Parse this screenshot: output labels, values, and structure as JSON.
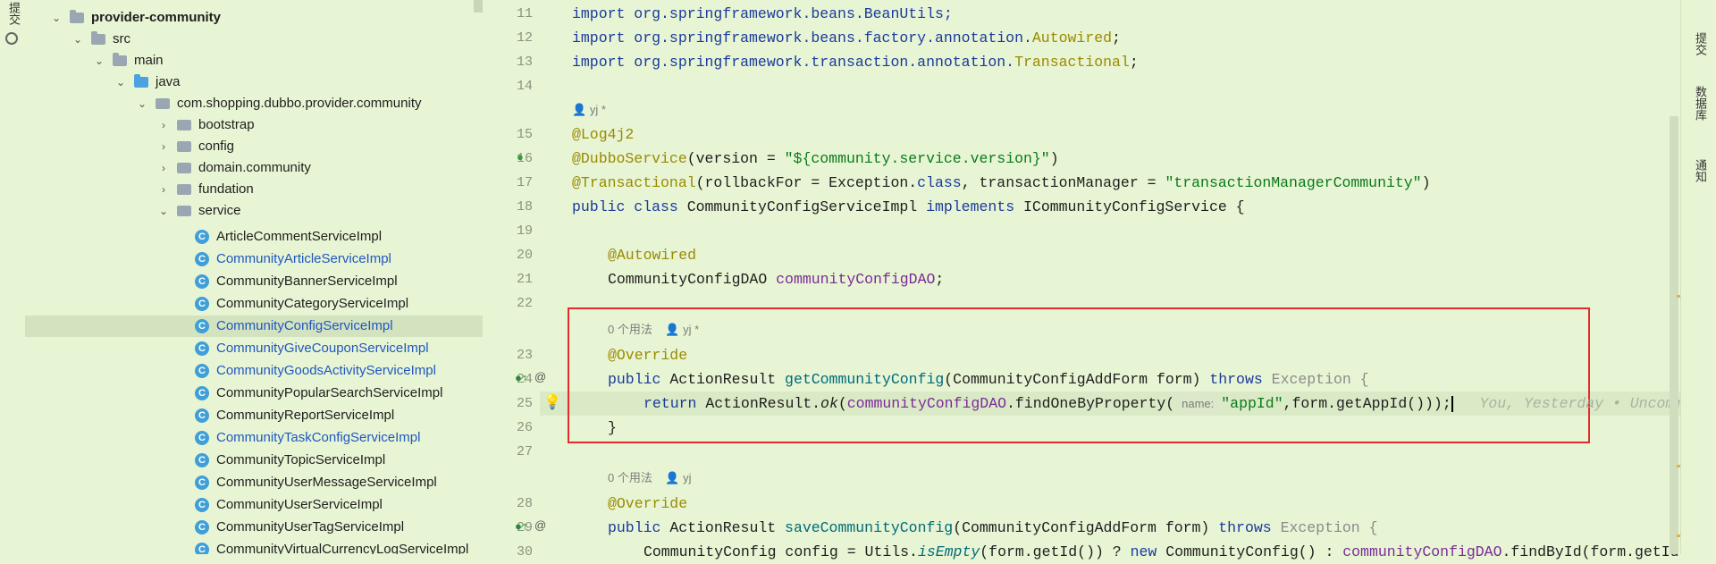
{
  "left_strip": {
    "label": "提交"
  },
  "tree": {
    "items": [
      {
        "label": "provider-community",
        "depth": 0
      },
      {
        "label": "src",
        "depth": 1
      },
      {
        "label": "main",
        "depth": 2
      },
      {
        "label": "java",
        "depth": 3
      },
      {
        "label": "com.shopping.dubbo.provider.community",
        "depth": 4
      },
      {
        "label": "bootstrap",
        "depth": 5
      },
      {
        "label": "config",
        "depth": 5
      },
      {
        "label": "domain.community",
        "depth": 5
      },
      {
        "label": "fundation",
        "depth": 5
      },
      {
        "label": "service",
        "depth": 5
      },
      {
        "label": "ArticleCommentServiceImpl"
      },
      {
        "label": "CommunityArticleServiceImpl"
      },
      {
        "label": "CommunityBannerServiceImpl"
      },
      {
        "label": "CommunityCategoryServiceImpl"
      },
      {
        "label": "CommunityConfigServiceImpl"
      },
      {
        "label": "CommunityGiveCouponServiceImpl"
      },
      {
        "label": "CommunityGoodsActivityServiceImpl"
      },
      {
        "label": "CommunityPopularSearchServiceImpl"
      },
      {
        "label": "CommunityReportServiceImpl"
      },
      {
        "label": "CommunityTaskConfigServiceImpl"
      },
      {
        "label": "CommunityTopicServiceImpl"
      },
      {
        "label": "CommunityUserMessageServiceImpl"
      },
      {
        "label": "CommunityUserServiceImpl"
      },
      {
        "label": "CommunityUserTagServiceImpl"
      },
      {
        "label": "CommunityVirtualCurrencyLogServiceImpl"
      }
    ]
  },
  "editor": {
    "line_numbers": [
      "11",
      "12",
      "13",
      "14",
      "15",
      "16",
      "17",
      "18",
      "19",
      "20",
      "21",
      "22",
      "23",
      "24",
      "25",
      "26",
      "27",
      "28",
      "29",
      "30"
    ],
    "code": {
      "l11": "import org.springframework.beans.BeanUtils;",
      "l12a": "import org.springframework.beans.factory.annotation.",
      "l12b": "Autowired",
      "l13a": "import org.springframework.transaction.annotation.",
      "l13b": "Transactional",
      "l15": "@Log4j2",
      "l16a": "@DubboService",
      "l16b": "(version = ",
      "l16c": "\"${community.service.version}\"",
      "l16d": ")",
      "l17a": "@Transactional",
      "l17b": "(rollbackFor = Exception.",
      "l17c": "class",
      "l17d": ", transactionManager = ",
      "l17e": "\"transactionManagerCommunity\"",
      "l17f": ")",
      "l18a": "public class",
      "l18b": " CommunityConfigServiceImpl ",
      "l18c": "implements",
      "l18d": " ICommunityConfigService {",
      "l20": "@Autowired",
      "l21a": "CommunityConfigDAO ",
      "l21b": "communityConfigDAO",
      "l21c": ";",
      "l23": "@Override",
      "l24a": "public",
      "l24b": " ActionResult ",
      "l24c": "getCommunityConfig",
      "l24d": "(CommunityConfigAddForm form) ",
      "l24e": "throws",
      "l24f": " Exception {",
      "l25a": "return",
      "l25b": " ActionResult.",
      "l25c": "ok",
      "l25d": "(",
      "l25e": "communityConfigDAO",
      "l25f": ".findOneByProperty(",
      "l25g": "name:",
      "l25h": "\"appId\"",
      "l25i": ",form.getAppId()));",
      "l25j": "You, Yesterday • Uncomm",
      "l26": "}",
      "l28": "@Override",
      "l29a": "public",
      "l29b": " ActionResult ",
      "l29c": "saveCommunityConfig",
      "l29d": "(CommunityConfigAddForm form) ",
      "l29e": "throws",
      "l29f": " Exception {",
      "l30a": "CommunityConfig config = Utils.",
      "l30b": "isEmpty",
      "l30c": "(form.getId()) ? ",
      "l30d": "new",
      "l30e": " CommunityConfig() : ",
      "l30f": "communityConfigDAO",
      "l30g": ".findById(form.getId"
    },
    "hints": {
      "author_class": "yj *",
      "usages_1": "0 个用法",
      "author_1": "yj *",
      "usages_2": "0 个用法",
      "author_2": "yj"
    }
  },
  "right_strip": {
    "label_1": "提交",
    "label_2": "数据库",
    "label_3": "通知"
  },
  "colors": {
    "background": "#e8f5d4",
    "highlight_box": "#e32b2b"
  }
}
